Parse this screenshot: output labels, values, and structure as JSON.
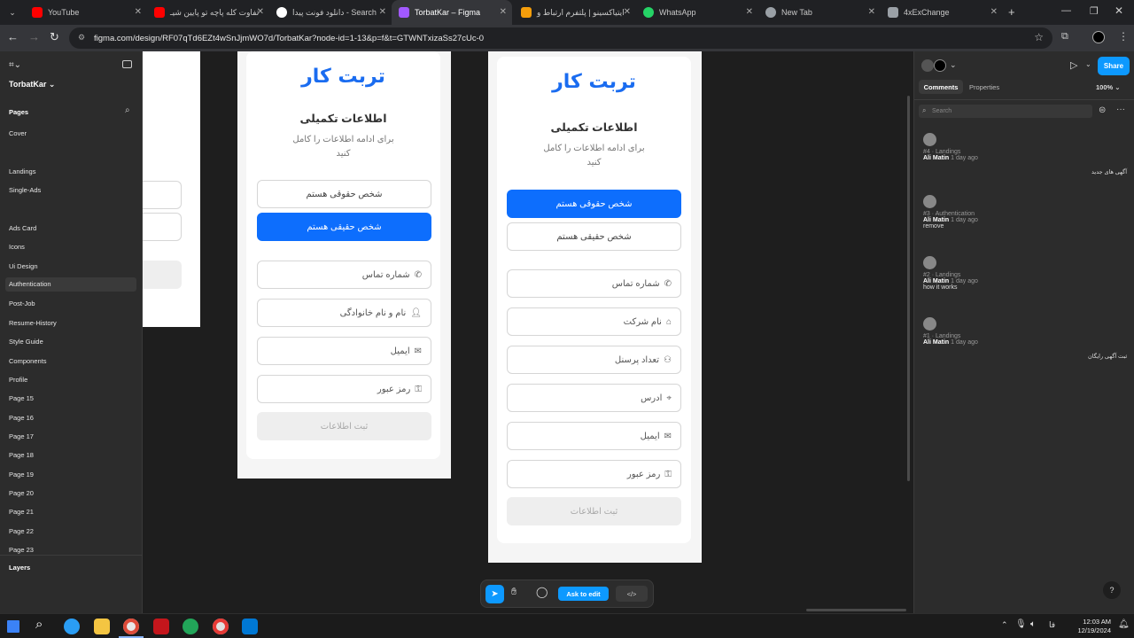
{
  "browser": {
    "tabs": [
      {
        "title": "YouTube",
        "color": "#ff0000"
      },
      {
        "title": "تفاوت کله پاچه تو پایین شیـ",
        "color": "#ff0000"
      },
      {
        "title": "دانلود فونت پیدا - Search",
        "color": "#ffffff"
      },
      {
        "title": "TorbatKar – Figma",
        "color": "#a259ff"
      },
      {
        "title": "ایتیاکسینو | پلتفرم ارتباط و",
        "color": "#f59e0b"
      },
      {
        "title": "WhatsApp",
        "color": "#25d366"
      },
      {
        "title": "New Tab",
        "color": "#9aa0a6"
      },
      {
        "title": "4xExChange",
        "color": "#9aa0a6"
      }
    ],
    "url": "figma.com/design/RF07qTd6EZt4wSnJjmWO7d/TorbatKar?node-id=1-13&p=f&t=GTWNTxizaSs27cUc-0"
  },
  "left_panel": {
    "file_name": "TorbatKar",
    "pages_label": "Pages",
    "pages": [
      "Cover",
      "Landings",
      "Single-Ads",
      "Ads Card",
      "Icons",
      "Ui Design",
      "Authentication",
      "Post-Job",
      "Resume-History",
      "Style Guide",
      "Components",
      "Profile",
      "Page 15",
      "Page 16",
      "Page 17",
      "Page 18",
      "Page 19",
      "Page 20",
      "Page 21",
      "Page 22",
      "Page 23"
    ],
    "layers_label": "Layers"
  },
  "frame_a": {
    "logo": "تربت کار",
    "title": "اطلاعات تکمیلی",
    "subtitle_1": "برای ادامه اطلاعات را کامل",
    "subtitle_2": "کنید",
    "legal_button": "شخص حقوقی هستم",
    "real_button": "شخص حقیقی هستم",
    "fields": [
      "شماره تماس",
      "نام و نام خانوادگی",
      "ایمیل",
      "رمز عبور"
    ],
    "submit": "ثبت اطلاعات"
  },
  "frame_b": {
    "logo": "تربت کار",
    "title": "اطلاعات تکمیلی",
    "subtitle_1": "برای ادامه اطلاعات را کامل",
    "subtitle_2": "کنید",
    "legal_button": "شخص حقوقی هستم",
    "real_button": "شخص حقیقی هستم",
    "fields": [
      "شماره تماس",
      "نام شرکت",
      "تعداد پرسنل",
      "ادرس",
      "ایمیل",
      "رمز عبور"
    ],
    "submit": "ثبت اطلاعات"
  },
  "right_panel": {
    "share": "Share",
    "tab_comments": "Comments",
    "tab_properties": "Properties",
    "zoom": "100%",
    "search_placeholder": "Search",
    "comments": [
      {
        "ref": "#4 · Landings",
        "author": "Ali Matin",
        "time": "1 day ago",
        "text": "",
        "side_text": "آگهی های جدید"
      },
      {
        "ref": "#3 · Authentication",
        "author": "Ali Matin",
        "time": "1 day ago",
        "text": "remove",
        "side_text": ""
      },
      {
        "ref": "#2 · Landings",
        "author": "Ali Matin",
        "time": "1 day ago",
        "text": "how it works",
        "side_text": ""
      },
      {
        "ref": "#1 · Landings",
        "author": "Ali Matin",
        "time": "1 day ago",
        "text": "",
        "side_text": "ثبت آگهی رایگان"
      }
    ]
  },
  "toolbar": {
    "ask_to_edit": "Ask to edit",
    "code_label": "</>"
  },
  "taskbar": {
    "time": "12:03 AM",
    "date": "12/19/2024",
    "lang": "فا"
  }
}
